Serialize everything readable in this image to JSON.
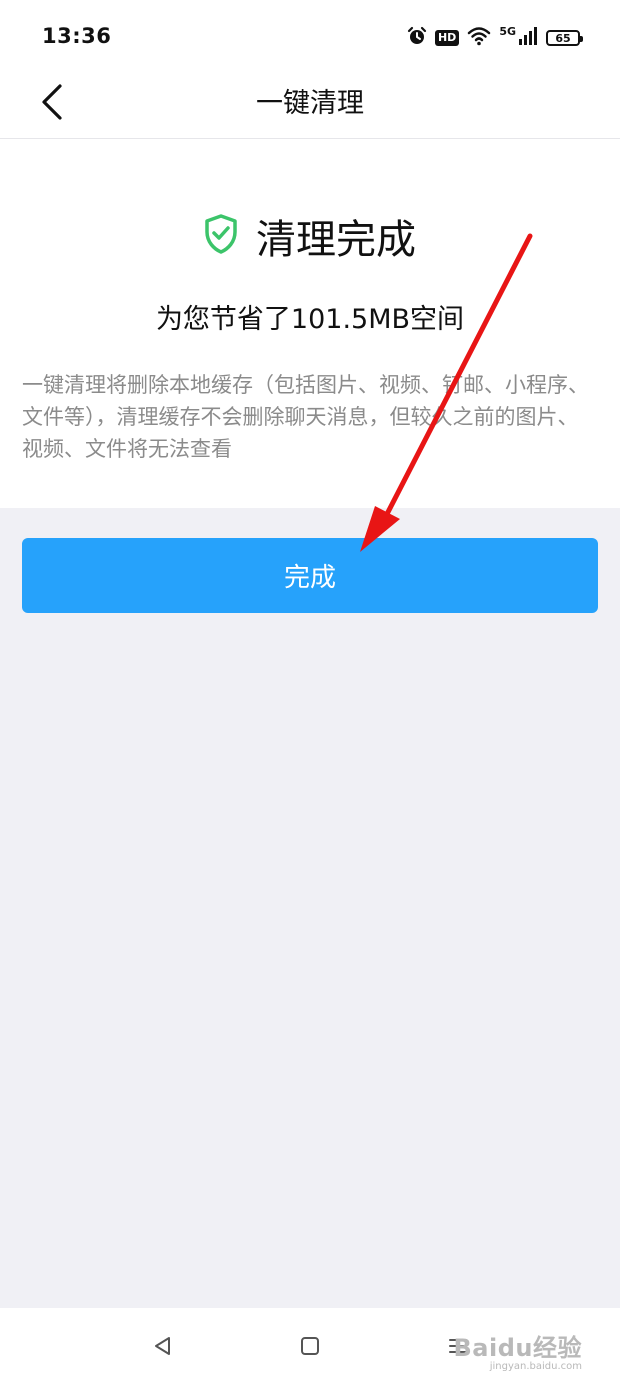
{
  "status_bar": {
    "time": "13:36",
    "hd": "HD",
    "network": "5G",
    "battery": "65"
  },
  "header": {
    "title": "一键清理"
  },
  "result": {
    "title": "清理完成",
    "saved": "为您节省了101.5MB空间",
    "description": "一键清理将删除本地缓存（包括图片、视频、钉邮、小程序、文件等），清理缓存不会删除聊天消息，但较久之前的图片、视频、文件将无法查看"
  },
  "actions": {
    "done_label": "完成"
  },
  "watermark": {
    "main": "Baidu经验",
    "sub": "jingyan.baidu.com"
  },
  "colors": {
    "accent": "#26a2fb",
    "shield": "#3cc46a",
    "annotation_arrow": "#e81515"
  }
}
